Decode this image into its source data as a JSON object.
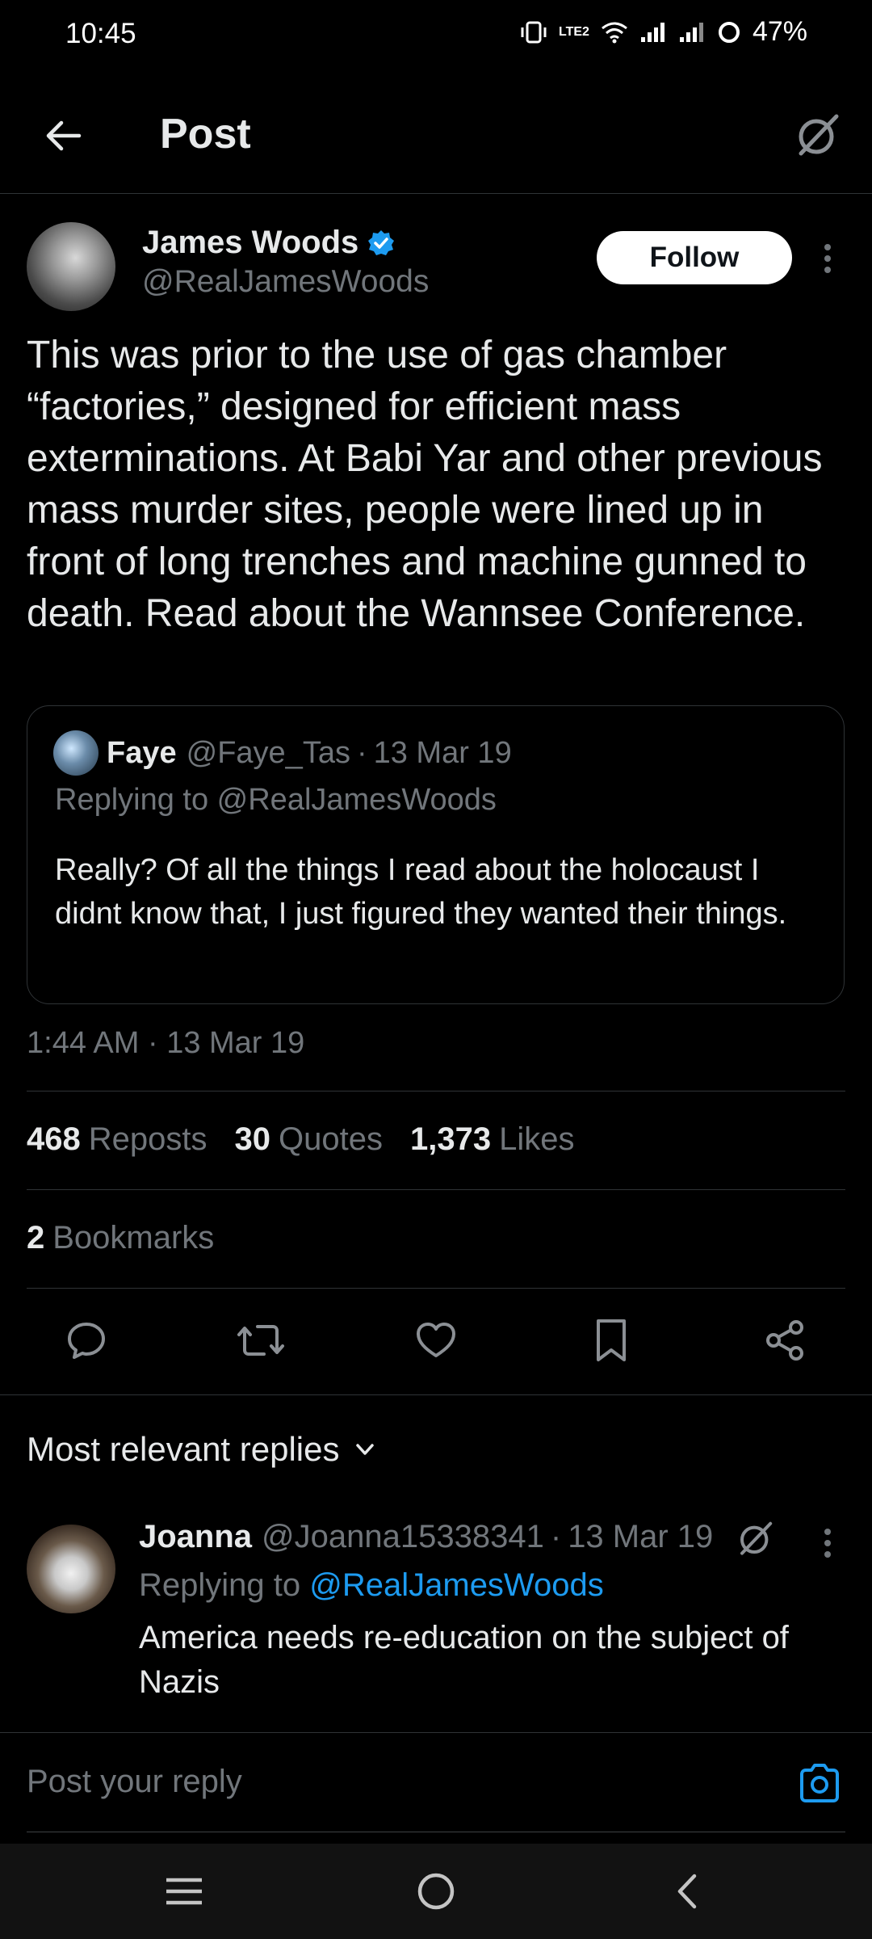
{
  "status_bar": {
    "time": "10:45",
    "battery": "47%",
    "network_label": "LTE2"
  },
  "header": {
    "title": "Post",
    "back_icon": "arrow-left-icon",
    "grok_icon": "grok-icon"
  },
  "post": {
    "author_name": "James Woods",
    "author_handle": "@RealJamesWoods",
    "follow_label": "Follow",
    "text": "This was prior to the use of gas chamber “factories,” designed for efficient mass exterminations. At Babi Yar and other previous mass murder sites, people were lined up in front of long trenches and machine gunned to death. Read about the Wannsee Conference.",
    "timestamp": "1:44 AM · 13 Mar 19",
    "verified_color": "#1d9bf0"
  },
  "quote": {
    "name": "Faye",
    "handle": "@Faye_Tas",
    "dot": "·",
    "date": "13 Mar 19",
    "replying": "Replying to @RealJamesWoods",
    "text": "Really? Of all the things I read about the holocaust I didnt know that, I just figured they wanted their things."
  },
  "stats": {
    "reposts_count": "468",
    "reposts_label": "Reposts",
    "quotes_count": "30",
    "quotes_label": "Quotes",
    "likes_count": "1,373",
    "likes_label": "Likes",
    "bookmarks_count": "2",
    "bookmarks_label": "Bookmarks"
  },
  "actions": [
    "reply-icon",
    "repost-icon",
    "like-icon",
    "bookmark-icon",
    "share-icon"
  ],
  "replies": {
    "sort_label": "Most relevant replies",
    "items": [
      {
        "name": "Joanna",
        "handle": "@Joanna15338341",
        "dot": "·",
        "date": "13 Mar 19",
        "replying_prefix": "Replying to",
        "replying_mention": "@RealJamesWoods",
        "text": "America needs re-education on the subject of Nazis"
      }
    ]
  },
  "compose": {
    "placeholder": "Post your reply"
  },
  "colors": {
    "accent": "#1d9bf0",
    "background": "#000000",
    "muted_text": "#71767b",
    "divider": "#2f3336"
  }
}
